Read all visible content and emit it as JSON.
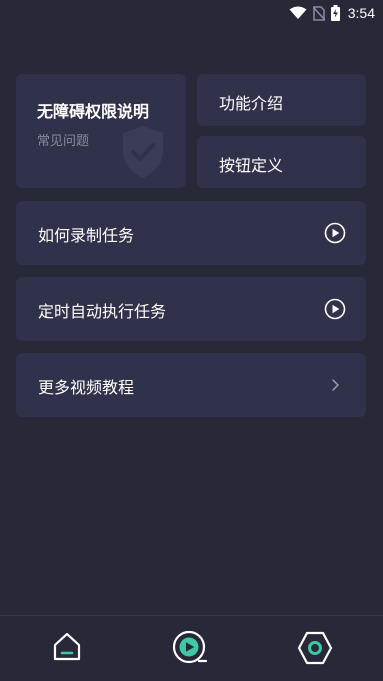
{
  "status_bar": {
    "time": "3:54",
    "icons": [
      "wifi-icon",
      "no-sim-icon",
      "battery-charging-icon"
    ]
  },
  "permission_card": {
    "title": "无障碍权限说明",
    "subtitle": "常见问题",
    "icon": "shield-check-icon"
  },
  "feature_intro": {
    "label": "功能介绍"
  },
  "button_definition": {
    "label": "按钮定义"
  },
  "rows": [
    {
      "label": "如何录制任务",
      "icon": "play-circle-icon"
    },
    {
      "label": "定时自动执行任务",
      "icon": "play-circle-icon"
    },
    {
      "label": "更多视频教程",
      "icon": "chevron-right-icon"
    }
  ],
  "bottom_nav": [
    {
      "name": "home",
      "icon": "home-icon"
    },
    {
      "name": "video-tutorial",
      "icon": "video-play-icon",
      "active_color": "#3ec9a2"
    },
    {
      "name": "settings",
      "icon": "hexagon-settings-icon"
    }
  ],
  "colors": {
    "background": "#272838",
    "card": "#30314a",
    "accent": "#3ec9a2",
    "muted_text": "#8a8ba3"
  }
}
